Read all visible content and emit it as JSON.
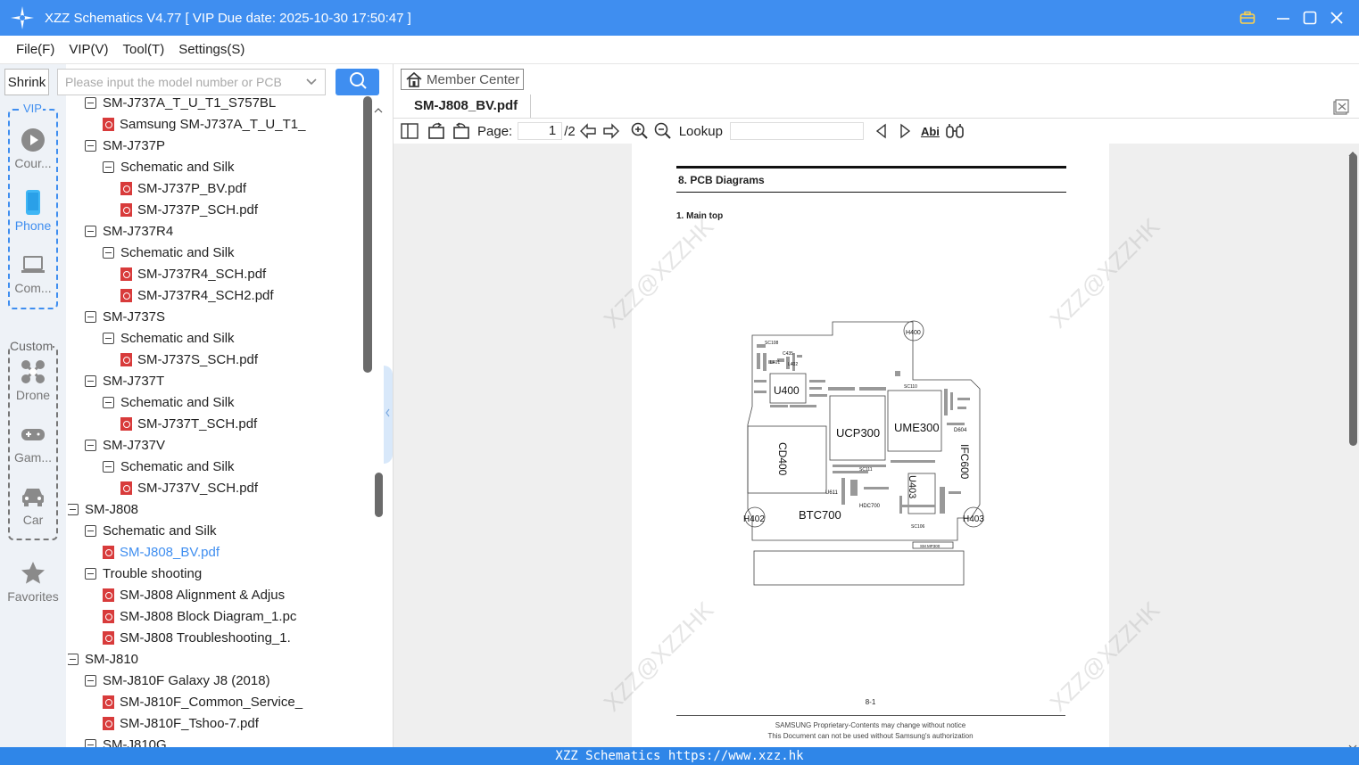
{
  "window": {
    "title": "XZZ Schematics V4.77 [ VIP Due date: 2025-10-30 17:50:47 ]"
  },
  "menu": {
    "items": [
      "File(F)",
      "VIP(V)",
      "Tool(T)",
      "Settings(S)"
    ]
  },
  "left": {
    "shrink_label": "Shrink",
    "vip_label": "VIP",
    "custom_label": "Custom",
    "nav": [
      {
        "label": "Cour...",
        "icon": "play-icon"
      },
      {
        "label": "Phone",
        "icon": "phone-icon"
      },
      {
        "label": "Com...",
        "icon": "laptop-icon"
      },
      {
        "label": "Drone",
        "icon": "drone-icon"
      },
      {
        "label": "Gam...",
        "icon": "gamepad-icon"
      },
      {
        "label": "Car",
        "icon": "car-icon"
      },
      {
        "label": "Favorites",
        "icon": "star-icon"
      }
    ]
  },
  "search": {
    "placeholder": "Please input the model number or PCB"
  },
  "tree": [
    {
      "label": "SM-J737A_T_U_T1_S757BL",
      "type": "folder",
      "level": 1
    },
    {
      "label": "Samsung SM-J737A_T_U_T1_",
      "type": "pdf",
      "level": 2
    },
    {
      "label": "SM-J737P",
      "type": "folder",
      "level": 1
    },
    {
      "label": "Schematic and Silk",
      "type": "folder",
      "level": 2
    },
    {
      "label": "SM-J737P_BV.pdf",
      "type": "pdf",
      "level": 3
    },
    {
      "label": "SM-J737P_SCH.pdf",
      "type": "pdf",
      "level": 3
    },
    {
      "label": "SM-J737R4",
      "type": "folder",
      "level": 1
    },
    {
      "label": "Schematic and Silk",
      "type": "folder",
      "level": 2
    },
    {
      "label": "SM-J737R4_SCH.pdf",
      "type": "pdf",
      "level": 3
    },
    {
      "label": "SM-J737R4_SCH2.pdf",
      "type": "pdf",
      "level": 3
    },
    {
      "label": "SM-J737S",
      "type": "folder",
      "level": 1
    },
    {
      "label": "Schematic and Silk",
      "type": "folder",
      "level": 2
    },
    {
      "label": "SM-J737S_SCH.pdf",
      "type": "pdf",
      "level": 3
    },
    {
      "label": "SM-J737T",
      "type": "folder",
      "level": 1
    },
    {
      "label": "Schematic and Silk",
      "type": "folder",
      "level": 2
    },
    {
      "label": "SM-J737T_SCH.pdf",
      "type": "pdf",
      "level": 3
    },
    {
      "label": "SM-J737V",
      "type": "folder",
      "level": 1
    },
    {
      "label": "Schematic and Silk",
      "type": "folder",
      "level": 2
    },
    {
      "label": "SM-J737V_SCH.pdf",
      "type": "pdf",
      "level": 3
    },
    {
      "label": "SM-J808",
      "type": "folder",
      "level": 0
    },
    {
      "label": "Schematic and Silk",
      "type": "folder",
      "level": 1
    },
    {
      "label": "SM-J808_BV.pdf",
      "type": "pdf",
      "level": 2,
      "selected": true
    },
    {
      "label": "Trouble shooting",
      "type": "folder",
      "level": 1
    },
    {
      "label": "SM-J808 Alignment & Adjus",
      "type": "pdf",
      "level": 2
    },
    {
      "label": "SM-J808 Block Diagram_1.pc",
      "type": "pdf",
      "level": 2
    },
    {
      "label": "SM-J808 Troubleshooting_1.",
      "type": "pdf",
      "level": 2
    },
    {
      "label": "SM-J810",
      "type": "folder",
      "level": 0
    },
    {
      "label": "SM-J810F Galaxy J8 (2018)",
      "type": "folder",
      "level": 1
    },
    {
      "label": "SM-J810F_Common_Service_",
      "type": "pdf",
      "level": 2
    },
    {
      "label": "SM-J810F_Tshoo-7.pdf",
      "type": "pdf",
      "level": 2
    },
    {
      "label": "SM-J810G",
      "type": "folder",
      "level": 1
    }
  ],
  "viewer": {
    "member_center": "Member Center",
    "tab_title": "SM-J808_BV.pdf",
    "page_label": "Page:",
    "page_current": "1",
    "page_total": "/2",
    "lookup_label": "Lookup",
    "lookup_value": "",
    "abi_label": "Abi"
  },
  "document": {
    "section_title": "8.  PCB  Diagrams",
    "subsection": "1.  Main  top",
    "page_number": "8-1",
    "footer_line1": "SAMSUNG Proprietary-Contents may change without notice",
    "footer_line2": "This Document can not be used without Samsung's authorization",
    "watermark": "XZZ@XZZHK",
    "components": {
      "h400": "H400",
      "sc108": "SC108",
      "c435": "C435",
      "l401": "L401",
      "l402": "L402",
      "u400": "U400",
      "sc110": "SC110",
      "ucp300": "UCP300",
      "ume300": "UME300",
      "d604": "D604",
      "cd400": "CD400",
      "ifc600": "IFC600",
      "sc111": "SC111",
      "u403": "U403",
      "u611": "U611",
      "hdc700": "HDC700",
      "h402": "H402",
      "btc700": "BTC700",
      "h403": "H403",
      "sc106": "SC106",
      "sm_mp300": "SM MP300"
    }
  },
  "status": {
    "text": "XZZ Schematics https://www.xzz.hk"
  },
  "colors": {
    "accent": "#3f8ef0",
    "pdf_red": "#d83b3b"
  }
}
